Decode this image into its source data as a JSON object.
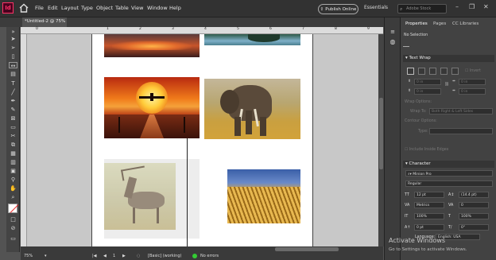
{
  "menu": {
    "items": [
      "File",
      "Edit",
      "Layout",
      "Type",
      "Object",
      "Table",
      "View",
      "Window",
      "Help"
    ],
    "publish": "Publish Online",
    "workspace": "Essentials",
    "search_placeholder": "Adobe Stock"
  },
  "document": {
    "tab": "*Untitled-2 @ 75%"
  },
  "ruler": {
    "ticks": [
      "0",
      "1",
      "2",
      "3",
      "4",
      "5",
      "6",
      "7",
      "8",
      "9"
    ]
  },
  "status": {
    "zoom": "75%",
    "page": "1",
    "style": "[Basic] (working)",
    "errors": "No errors"
  },
  "panel": {
    "tabs": [
      "Properties",
      "Pages",
      "CC Libraries"
    ],
    "selection": "No Selection",
    "text_wrap": {
      "title": "Text Wrap",
      "invert": "Invert",
      "offsets": [
        "0 in",
        "0 in",
        "0 in",
        "0 in"
      ],
      "wrap_options_label": "Wrap Options:",
      "wrap_to_label": "Wrap To:",
      "wrap_to_value": "Both Right & Left Sides",
      "contour_label": "Contour Options:",
      "type_label": "Type:",
      "include_edges": "Include Inside Edges"
    },
    "character": {
      "title": "Character",
      "font": "Minion Pro",
      "style": "Regular",
      "size": "12 pt",
      "leading": "(14.4 pt)",
      "kerning": "Metrics",
      "tracking": "0",
      "vscale": "100%",
      "hscale": "100%",
      "baseline": "0 pt",
      "skew": "0°",
      "language_label": "Language:",
      "language": "English: USA"
    }
  },
  "watermark": {
    "title": "Activate Windows",
    "subtitle": "Go to Settings to activate Windows."
  },
  "colors": {
    "accent": "#5c8fd6",
    "panel": "#424242",
    "menubar": "#323232"
  }
}
